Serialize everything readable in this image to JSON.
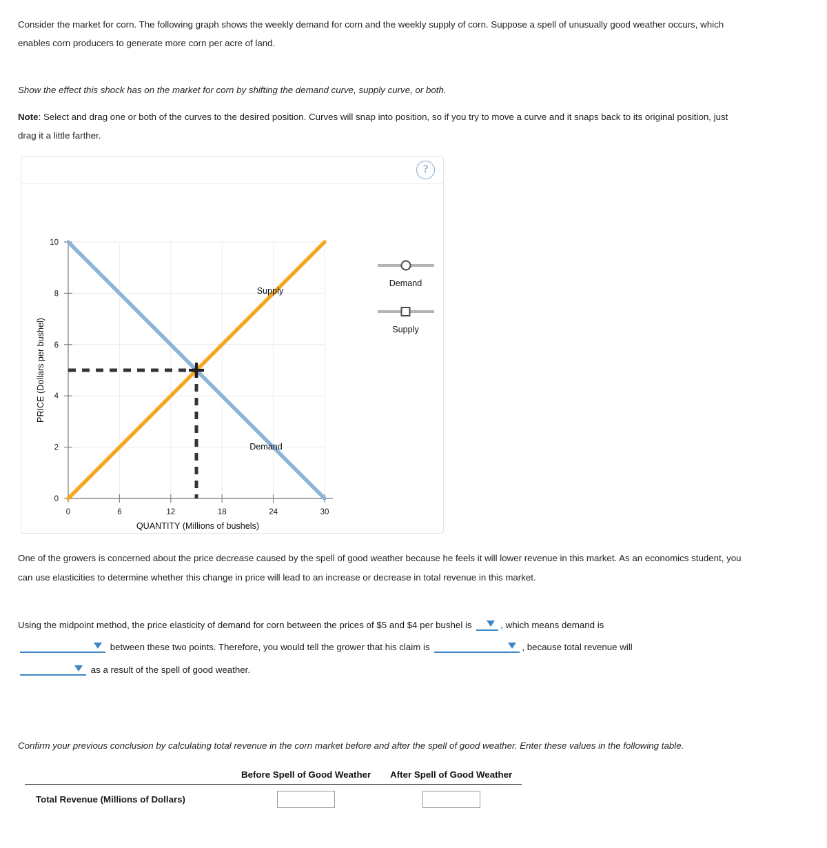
{
  "intro": {
    "paragraph": "Consider the market for corn. The following graph shows the weekly demand for corn and the weekly supply of corn. Suppose a spell of unusually good weather occurs, which enables corn producers to generate more corn per acre of land.",
    "instruction_italic": "Show the effect this shock has on the market for corn by shifting the demand curve, supply curve, or both.",
    "note_label": "Note",
    "note_text": ": Select and drag one or both of the curves to the desired position. Curves will snap into position, so if you try to move a curve and it snaps back to its original position, just drag it a little farther."
  },
  "graph_panel": {
    "help_icon": "?",
    "help_glyph": "question-mark"
  },
  "chart_data": {
    "type": "line",
    "title": "",
    "xlabel": "QUANTITY (Millions of bushels)",
    "ylabel": "PRICE (Dollars per bushel)",
    "xlim": [
      0,
      30
    ],
    "ylim": [
      0,
      10
    ],
    "xticks": [
      0,
      6,
      12,
      18,
      24,
      30
    ],
    "yticks": [
      0,
      2,
      4,
      6,
      8,
      10
    ],
    "grid": true,
    "legend_position": "right",
    "series": [
      {
        "name": "Demand",
        "color": "#8cb4d8",
        "marker": "circle",
        "inline_label": "Demand",
        "points": [
          {
            "x": 0,
            "y": 10
          },
          {
            "x": 30,
            "y": 0
          }
        ]
      },
      {
        "name": "Supply",
        "color": "#f5a623",
        "marker": "square",
        "inline_label": "Supply",
        "points": [
          {
            "x": 0,
            "y": 0
          },
          {
            "x": 30,
            "y": 10
          }
        ]
      }
    ],
    "equilibrium": {
      "label": "equilibrium",
      "x": 15,
      "y": 5,
      "marker": "cross",
      "dashed_color": "#333333"
    }
  },
  "revenue_text": {
    "paragraph": "One of the growers is concerned about the price decrease caused by the spell of good weather because he feels it will lower revenue in this market. As an economics student, you can use elasticities to determine whether this change in price will lead to an increase or decrease in total revenue in this market."
  },
  "elasticity_question": {
    "seg1": "Using the midpoint method, the price elasticity of demand for corn between the prices of $5 and $4 per bushel is",
    "dropdown1_value": "",
    "seg2": ", which means demand is",
    "dropdown2_value": "",
    "seg3": "between these two points. Therefore, you would tell the grower that his claim is",
    "dropdown3_value": "",
    "seg4": ", because total revenue will",
    "dropdown4_value": "",
    "seg5": "as a result of the spell of good weather."
  },
  "confirm_text": {
    "italic": "Confirm your previous conclusion by calculating total revenue in the corn market before and after the spell of good weather. Enter these values in the following table."
  },
  "revenue_table": {
    "columns": [
      "",
      "Before Spell of Good Weather",
      "After Spell of Good Weather"
    ],
    "rows": [
      {
        "label": "Total Revenue (Millions of Dollars)",
        "before_value": "",
        "after_value": "",
        "before_placeholder": "",
        "after_placeholder": ""
      }
    ]
  },
  "colors": {
    "demand": "#8cb4d8",
    "supply": "#f5a623",
    "equilibrium_dash": "#333333",
    "dropdown_accent": "#3f86c4",
    "panel_border": "#e2e2e2",
    "grid": "#ececec"
  }
}
